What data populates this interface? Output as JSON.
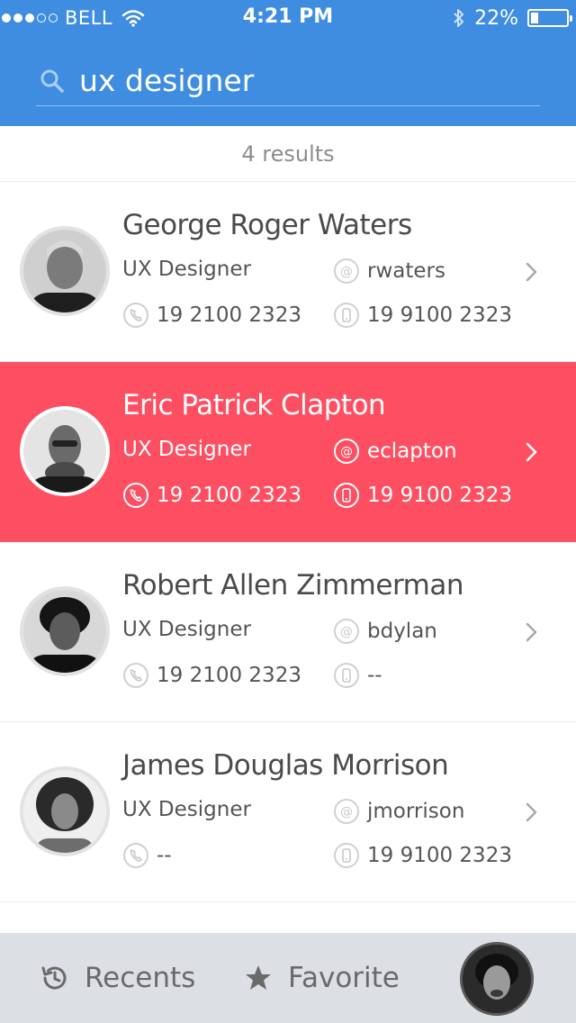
{
  "status_bar": {
    "carrier": "BELL",
    "time": "4:21 PM",
    "battery": "22%",
    "battery_level": 0.22,
    "signal_dots_filled": 3,
    "signal_dots_total": 5
  },
  "search": {
    "value": "ux designer",
    "icon": "search-icon"
  },
  "results": {
    "count_label": "4 results"
  },
  "contacts": [
    {
      "name": "George Roger Waters",
      "title": "UX Designer",
      "username": "rwaters",
      "phone": "19 2100 2323",
      "mobile": "19 9100 2323",
      "selected": false
    },
    {
      "name": "Eric Patrick Clapton",
      "title": "UX Designer",
      "username": "eclapton",
      "phone": "19 2100 2323",
      "mobile": "19 9100 2323",
      "selected": true
    },
    {
      "name": "Robert Allen Zimmerman",
      "title": "UX Designer",
      "username": "bdylan",
      "phone": "19 2100 2323",
      "mobile": "--",
      "selected": false
    },
    {
      "name": "James Douglas Morrison",
      "title": "UX Designer",
      "username": "jmorrison",
      "phone": "--",
      "mobile": "19 9100 2323",
      "selected": false
    }
  ],
  "tabbar": {
    "recents": "Recents",
    "favorite": "Favorite"
  },
  "colors": {
    "header": "#3f8de0",
    "selected_row": "#fd4f61",
    "tabbar": "#dcdfe3"
  }
}
